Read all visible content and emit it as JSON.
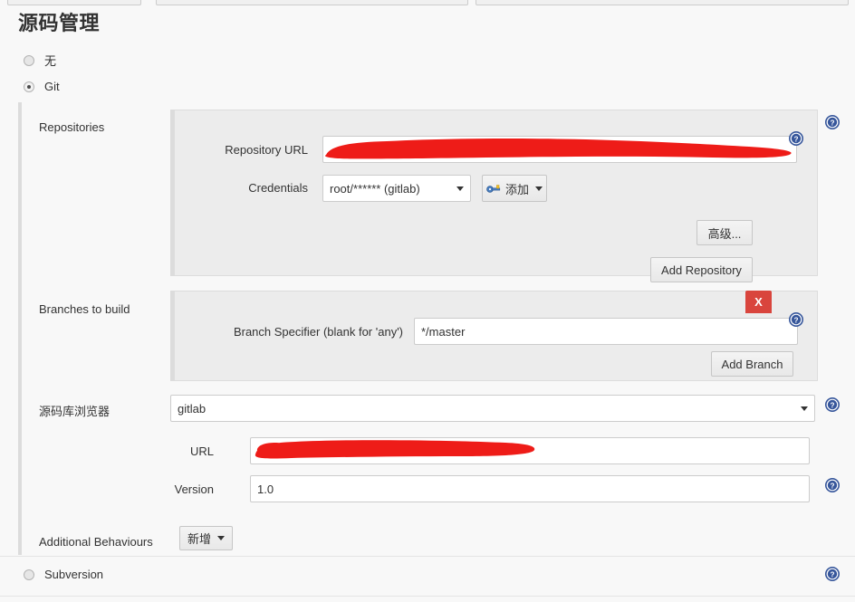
{
  "page": {
    "section_title": "源码管理"
  },
  "scm_options": [
    {
      "label": "无",
      "selected": false
    },
    {
      "label": "Git",
      "selected": true
    },
    {
      "label": "Subversion",
      "selected": false
    }
  ],
  "git": {
    "repositories": {
      "row_label": "Repositories",
      "repository_url": {
        "label": "Repository URL",
        "value": "",
        "redacted": true
      },
      "credentials": {
        "label": "Credentials",
        "value": "root/****** (gitlab)",
        "add_button": "添加"
      },
      "advanced_button": "高级...",
      "add_repository_button": "Add Repository"
    },
    "branches": {
      "row_label": "Branches to build",
      "branch_specifier": {
        "label": "Branch Specifier (blank for 'any')",
        "value": "*/master"
      },
      "delete_button": "X",
      "add_branch_button": "Add Branch"
    },
    "browser": {
      "row_label": "源码库浏览器",
      "selected": "gitlab",
      "url": {
        "label": "URL",
        "value": "",
        "redacted": true
      },
      "version": {
        "label": "Version",
        "value": "1.0"
      }
    },
    "additional_behaviours": {
      "row_label": "Additional Behaviours",
      "add_button": "新增"
    }
  },
  "icons": {
    "help": "help-icon",
    "key": "key-icon",
    "caret": "chevron-down-icon"
  },
  "colors": {
    "redaction": "#ee1c18",
    "delete_button": "#d9453d",
    "help_icon": "#36569b",
    "page_bg": "#f8f8f8",
    "panel_bg": "#ececec"
  }
}
